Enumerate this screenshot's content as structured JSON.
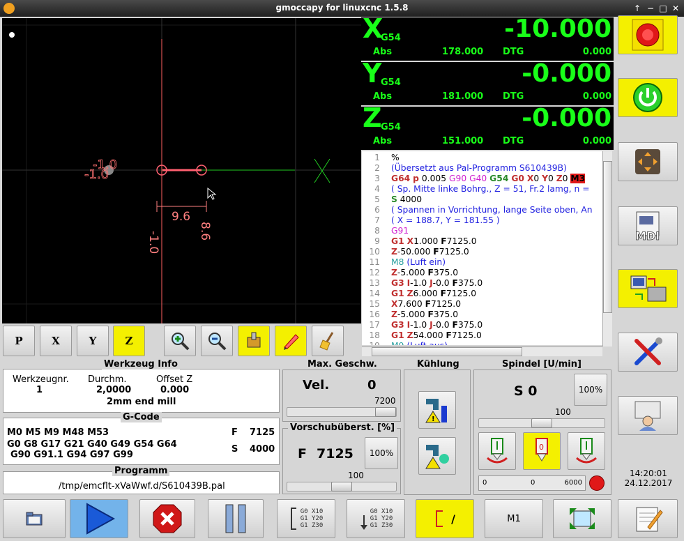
{
  "window": {
    "title": "gmoccapy for linuxcnc  1.5.8"
  },
  "preview": {
    "dim_width": "9.6",
    "dim_height": "-1.0",
    "dim_height_right": "8.6"
  },
  "view_buttons": [
    {
      "label": "P",
      "icon": "view-p-icon"
    },
    {
      "label": "X",
      "icon": "view-x-icon"
    },
    {
      "label": "Y",
      "icon": "view-y-icon"
    },
    {
      "label": "Z",
      "icon": "view-z-icon"
    },
    {
      "icon": "zoom-in-icon"
    },
    {
      "icon": "zoom-out-icon"
    },
    {
      "icon": "tool-measure-icon"
    },
    {
      "icon": "pencil-icon"
    },
    {
      "icon": "broom-icon"
    }
  ],
  "dro": [
    {
      "axis": "X",
      "system": "G54",
      "value": "-10.000",
      "abs_label": "Abs",
      "abs_value": "178.000",
      "dtg_label": "DTG",
      "dtg_value": "0.000"
    },
    {
      "axis": "Y",
      "system": "G54",
      "value": "-0.000",
      "abs_label": "Abs",
      "abs_value": "181.000",
      "dtg_label": "DTG",
      "dtg_value": "0.000"
    },
    {
      "axis": "Z",
      "system": "G54",
      "value": "-0.000",
      "abs_label": "Abs",
      "abs_value": "151.000",
      "dtg_label": "DTG",
      "dtg_value": "0.000"
    }
  ],
  "gcode_lines": [
    {
      "n": "1",
      "html": "<span class='bl'>%</span>"
    },
    {
      "n": "2",
      "html": "<span class='cm'>(Übersetzt aus Pal-Programm S610439B)</span>"
    },
    {
      "n": "3",
      "html": "<span class='kw'>G64</span> <span class='kw'>p</span> 0.005 <span class='mg'>G90 G40</span> <span class='gr'>G54</span> <span class='kw'>G0</span> <span class='kw'>X</span>0 <span class='kw'>Y</span>0 <span class='kw'>Z</span>0 <span class='rd'>M3</span>"
    },
    {
      "n": "4",
      "html": "<span class='cm'>( Sp. Mitte linke Bohrg., Z = 51, Fr.2 lamg, n =</span>"
    },
    {
      "n": "5",
      "html": "<span class='gr'>S</span> 4000"
    },
    {
      "n": "6",
      "html": "<span class='cm'>( Spannen in Vorrichtung, lange Seite oben, An</span>"
    },
    {
      "n": "7",
      "html": "<span class='cm'>( X = 188.7, Y = 181.55 )</span>"
    },
    {
      "n": "8",
      "html": "<span class='mg'>G91</span>"
    },
    {
      "n": "9",
      "html": "<span class='kw'>G1</span> <span class='kw'>X</span>1.000 <span class='bm'>F</span>7125.0"
    },
    {
      "n": "10",
      "html": "<span class='kw'>Z</span>-50.000 <span class='bm'>F</span>7125.0"
    },
    {
      "n": "11",
      "html": "<span class='cy'>M8</span> <span class='cm'>(Luft ein)</span>"
    },
    {
      "n": "12",
      "html": "<span class='kw'>Z</span>-5.000 <span class='bm'>F</span>375.0"
    },
    {
      "n": "13",
      "html": "<span class='kw'>G3</span> <span class='kw'>I</span>-1.0 <span class='kw'>J</span>-0.0 <span class='bm'>F</span>375.0"
    },
    {
      "n": "14",
      "html": "<span class='kw'>G1</span> <span class='kw'>Z</span>6.000 <span class='bm'>F</span>7125.0"
    },
    {
      "n": "15",
      "html": "<span class='kw'>X</span>7.600 <span class='bm'>F</span>7125.0"
    },
    {
      "n": "16",
      "html": "<span class='kw'>Z</span>-5.000 <span class='bm'>F</span>375.0"
    },
    {
      "n": "17",
      "html": "<span class='kw'>G3</span> <span class='kw'>I</span>-1.0 <span class='kw'>J</span>-0.0 <span class='bm'>F</span>375.0"
    },
    {
      "n": "18",
      "html": "<span class='kw'>G1</span> <span class='kw'>Z</span>54.000 <span class='bm'>F</span>7125.0"
    },
    {
      "n": "19",
      "html": "<span class='cy'>M9</span> <span class='cm'>(Luft aus)</span>"
    }
  ],
  "tool_info": {
    "title": "Werkzeug Info",
    "col1_label": "Werkzeugnr.",
    "col1_value": "1",
    "col2_label": "Durchm.",
    "col2_value": "2,0000",
    "col3_label": "Offset Z",
    "col3_value": "0.000",
    "description": "2mm end mill"
  },
  "gcode_info": {
    "title": "G-Code",
    "mcodes": "M0 M5 M9 M48 M53",
    "gcodes_1": "G0 G8 G17 G21 G40 G49 G54 G64",
    "gcodes_2": "G90 G91.1 G94 G97 G99",
    "f_label": "F",
    "f_value": "7125",
    "s_label": "S",
    "s_value": "4000"
  },
  "program": {
    "title": "Programm",
    "path": "/tmp/emcflt-xVaWwf.d/S610439B.pal"
  },
  "max_speed": {
    "title": "Max. Geschw.",
    "label": "Vel.",
    "value": "0",
    "slider_max": "7200",
    "level": 1.0
  },
  "feed_override": {
    "title": "Vorschubüberst. [%]",
    "label": "F",
    "value": "7125",
    "reset_label": "100%",
    "slider_value": "100",
    "level": 0.5
  },
  "coolant": {
    "title": "Kühlung"
  },
  "spindle": {
    "title": "Spindel [U/min]",
    "value": "S 0",
    "reset_label": "100%",
    "slider_value": "100",
    "level": 0.5,
    "bar_min": "0",
    "bar_value": "0",
    "bar_max": "6000"
  },
  "clock": {
    "time": "14:20:01",
    "date": "24.12.2017"
  },
  "bottom": {
    "m1_label": "M1",
    "step_label": "/",
    "skip_lines_1": "G0 X10\nG1 Y20\nG1 Z30",
    "skip_lines_2": "G0 X10\nG1 Y20\nG1 Z30"
  },
  "colors": {
    "dro_green": "#19ff19",
    "active_yellow": "#f4f000",
    "estop_red": "#e01818",
    "run_blue": "#73b3ea"
  }
}
